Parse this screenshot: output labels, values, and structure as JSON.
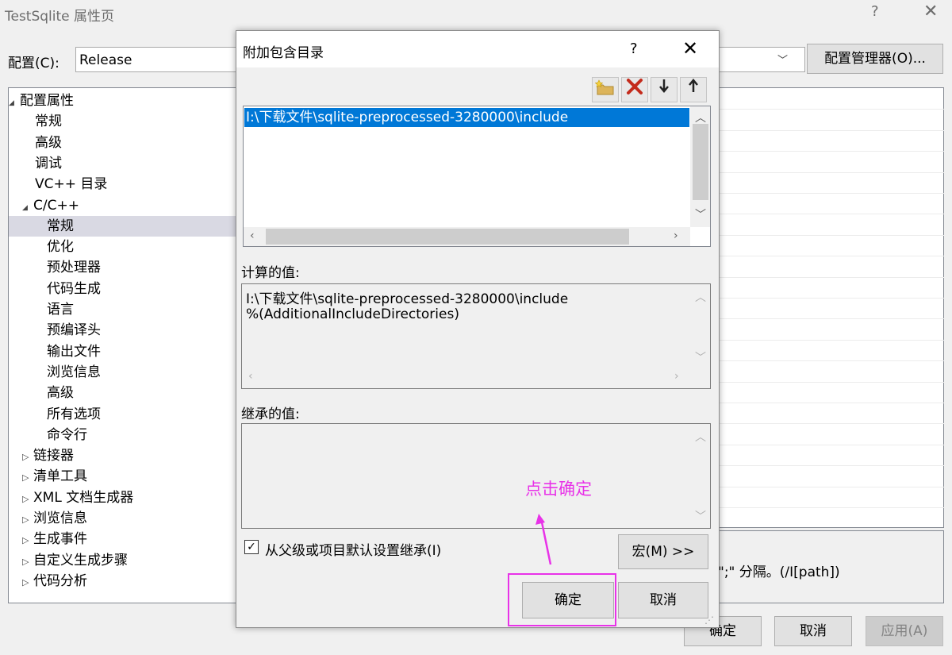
{
  "window": {
    "title": "TestSqlite 属性页",
    "help": "?",
    "close": "✕"
  },
  "config": {
    "label": "配置(C):",
    "value": "Release",
    "manager_button": "配置管理器(O)..."
  },
  "tree": [
    {
      "label": "配置属性",
      "expander": "◢",
      "level": 0
    },
    {
      "label": "常规",
      "level": 1
    },
    {
      "label": "高级",
      "level": 1
    },
    {
      "label": "调试",
      "level": 1
    },
    {
      "label": "VC++ 目录",
      "level": 1
    },
    {
      "label": "C/C++",
      "expander": "◢",
      "level": 1
    },
    {
      "label": "常规",
      "level": 2,
      "selected": true
    },
    {
      "label": "优化",
      "level": 2
    },
    {
      "label": "预处理器",
      "level": 2
    },
    {
      "label": "代码生成",
      "level": 2
    },
    {
      "label": "语言",
      "level": 2
    },
    {
      "label": "预编译头",
      "level": 2
    },
    {
      "label": "输出文件",
      "level": 2
    },
    {
      "label": "浏览信息",
      "level": 2
    },
    {
      "label": "高级",
      "level": 2
    },
    {
      "label": "所有选项",
      "level": 2
    },
    {
      "label": "命令行",
      "level": 2
    },
    {
      "label": "链接器",
      "expander": "▷",
      "level": 1
    },
    {
      "label": "清单工具",
      "expander": "▷",
      "level": 1
    },
    {
      "label": "XML 文档生成器",
      "expander": "▷",
      "level": 1
    },
    {
      "label": "浏览信息",
      "expander": "▷",
      "level": 1
    },
    {
      "label": "生成事件",
      "expander": "▷",
      "level": 1
    },
    {
      "label": "自定义生成步骤",
      "expander": "▷",
      "level": 1
    },
    {
      "label": "代码分析",
      "expander": "▷",
      "level": 1
    }
  ],
  "description_fragment": "\";\" 分隔。(/I[path])",
  "outer_buttons": {
    "ok": "确定",
    "cancel": "取消",
    "apply": "应用(A)"
  },
  "dialog": {
    "title": "附加包含目录",
    "help": "?",
    "close": "✕",
    "toolbar": {
      "new_line": "new-folder-icon",
      "delete": "delete-icon",
      "move_down": "arrow-down-icon",
      "move_up": "arrow-up-icon"
    },
    "list_items": [
      "I:\\下载文件\\sqlite-preprocessed-3280000\\include"
    ],
    "calculated_label": "计算的值:",
    "calculated_values": [
      "I:\\下载文件\\sqlite-preprocessed-3280000\\include",
      "%(AdditionalIncludeDirectories)"
    ],
    "inherited_label": "继承的值:",
    "inherit_checkbox": "从父级或项目默认设置继承(I)",
    "inherit_checked": true,
    "macro_button": "宏(M) >>",
    "ok_button": "确定",
    "cancel_button": "取消"
  },
  "annotation": {
    "text": "点击确定",
    "color": "#e832e8"
  }
}
